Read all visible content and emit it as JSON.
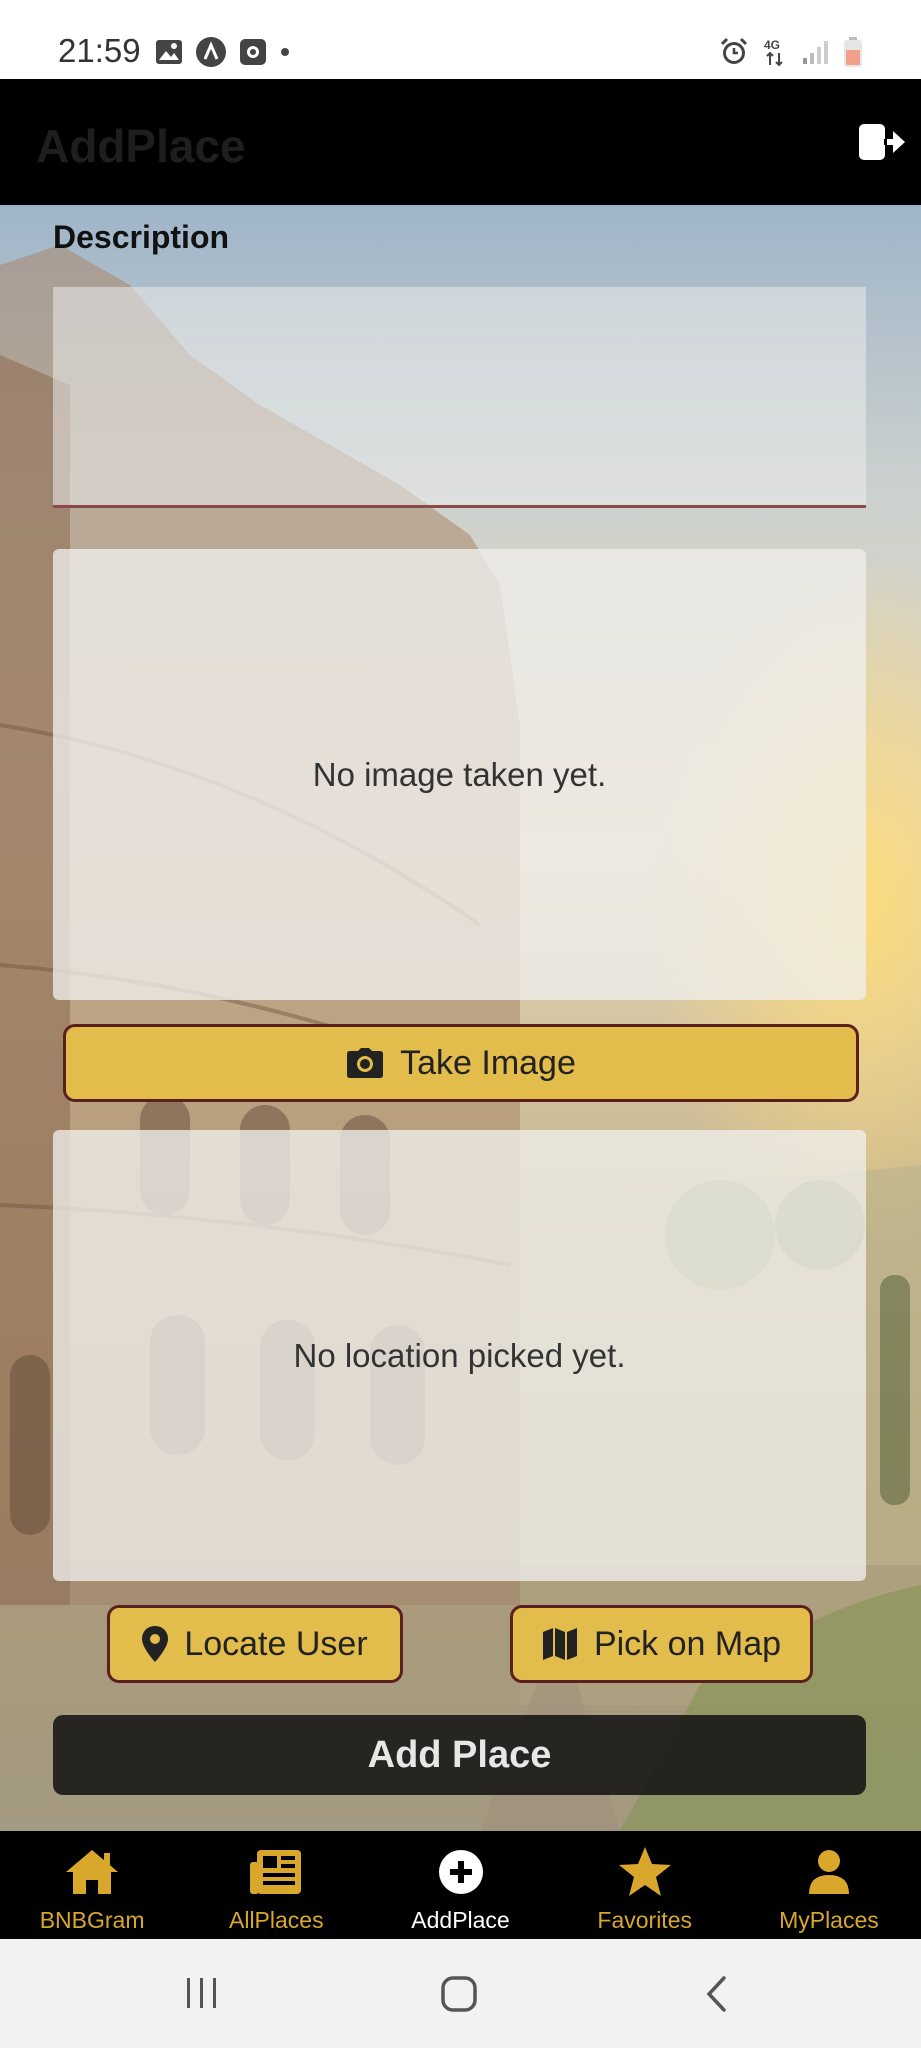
{
  "status_bar": {
    "time": "21:59",
    "left_icons": [
      "image-icon",
      "app-icon",
      "app-square-icon",
      "dot-icon"
    ],
    "right_icons": [
      "alarm-icon",
      "network-4g-icon",
      "signal-icon",
      "battery-low-icon"
    ]
  },
  "app_bar": {
    "title": "AddPlace",
    "action_icon": "logout-icon"
  },
  "form": {
    "description_label": "Description",
    "description_value": "",
    "image_preview_text": "No image taken yet.",
    "take_image_label": "Take Image",
    "location_preview_text": "No location picked yet.",
    "locate_user_label": "Locate User",
    "pick_on_map_label": "Pick on Map",
    "submit_label": "Add Place"
  },
  "bottom_nav": {
    "items": [
      {
        "label": "BNBGram",
        "icon": "home-icon",
        "active": false
      },
      {
        "label": "AllPlaces",
        "icon": "newspaper-icon",
        "active": false
      },
      {
        "label": "AddPlace",
        "icon": "plus-circle-icon",
        "active": true
      },
      {
        "label": "Favorites",
        "icon": "star-icon",
        "active": false
      },
      {
        "label": "MyPlaces",
        "icon": "user-icon",
        "active": false
      }
    ]
  },
  "colors": {
    "accent_gold": "#e2bd4c",
    "nav_gold": "#d9a72c",
    "button_border": "#5a1f1f",
    "app_bar_bg": "#000000"
  }
}
